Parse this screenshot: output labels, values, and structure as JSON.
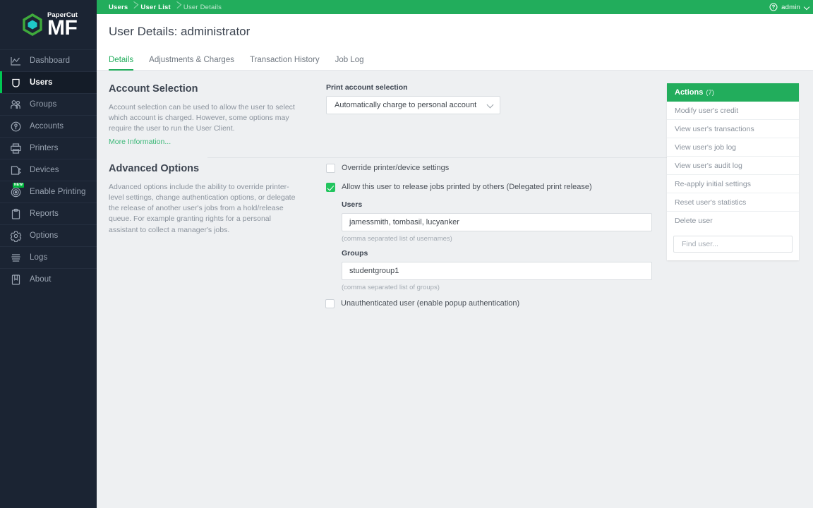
{
  "brand": {
    "name_top": "PaperCut",
    "name_main": "MF",
    "accent_green": "#22ad5c",
    "logo_hex_green": "#3faa3c",
    "logo_inner_teal": "#1ec8c8",
    "sidebar_bg": "#1b2433"
  },
  "sidebar": {
    "items": [
      {
        "label": "Dashboard",
        "icon": "chart-line-icon",
        "active": false,
        "badge": null
      },
      {
        "label": "Users",
        "icon": "shield-user-icon",
        "active": true,
        "badge": null
      },
      {
        "label": "Groups",
        "icon": "group-people-icon",
        "active": false,
        "badge": null
      },
      {
        "label": "Accounts",
        "icon": "coin-account-icon",
        "active": false,
        "badge": null
      },
      {
        "label": "Printers",
        "icon": "printer-icon",
        "active": false,
        "badge": null
      },
      {
        "label": "Devices",
        "icon": "device-icon",
        "active": false,
        "badge": null
      },
      {
        "label": "Enable Printing",
        "icon": "target-radar-icon",
        "active": false,
        "badge": "NEW"
      },
      {
        "label": "Reports",
        "icon": "clipboard-icon",
        "active": false,
        "badge": null
      },
      {
        "label": "Options",
        "icon": "gear-icon",
        "active": false,
        "badge": null
      },
      {
        "label": "Logs",
        "icon": "list-lines-icon",
        "active": false,
        "badge": null
      },
      {
        "label": "About",
        "icon": "book-bookmark-icon",
        "active": false,
        "badge": null
      }
    ]
  },
  "topbar": {
    "breadcrumbs": [
      {
        "label": "Users"
      },
      {
        "label": "User List"
      },
      {
        "label": "User Details"
      }
    ],
    "help_icon": "question-circle-icon",
    "account_label": "admin",
    "caret_icon": "chevron-down-icon"
  },
  "page": {
    "title": "User Details: administrator",
    "tabs": [
      {
        "label": "Details",
        "active": true
      },
      {
        "label": "Adjustments & Charges",
        "active": false
      },
      {
        "label": "Transaction History",
        "active": false
      },
      {
        "label": "Job Log",
        "active": false
      }
    ]
  },
  "account_selection": {
    "title": "Account Selection",
    "description": "Account selection can be used to allow the user to select which account is charged. However, some options may require the user to run the User Client.",
    "more_link": "More Information...",
    "field_label": "Print account selection",
    "selected_value": "Automatically charge to personal account",
    "caret_icon": "chevron-down-icon"
  },
  "advanced_options": {
    "title": "Advanced Options",
    "description": "Advanced options include the ability to override printer-level settings, change authentication options, or delegate the release of another user's jobs from a hold/release queue. For example granting rights for a personal assistant to collect a manager's jobs.",
    "override_checkbox": {
      "label": "Override printer/device settings",
      "checked": false
    },
    "delegate_checkbox": {
      "label": "Allow this user to release jobs printed by others (Delegated print release)",
      "checked": true
    },
    "users_label": "Users",
    "users_value": "jamessmith, tombasil, lucyanker",
    "users_hint": "(comma separated list of usernames)",
    "groups_label": "Groups",
    "groups_value": "studentgroup1",
    "groups_hint": "(comma separated list of groups)",
    "unauth_checkbox": {
      "label": "Unauthenticated user (enable popup authentication)",
      "checked": false
    }
  },
  "actions": {
    "title": "Actions",
    "count": "(7)",
    "items": [
      {
        "label": "Modify user's credit"
      },
      {
        "label": "View user's transactions"
      },
      {
        "label": "View user's job log"
      },
      {
        "label": "View user's audit log"
      },
      {
        "label": "Re-apply initial settings"
      },
      {
        "label": "Reset user's statistics"
      },
      {
        "label": "Delete user"
      }
    ],
    "find_placeholder": "Find user..."
  }
}
